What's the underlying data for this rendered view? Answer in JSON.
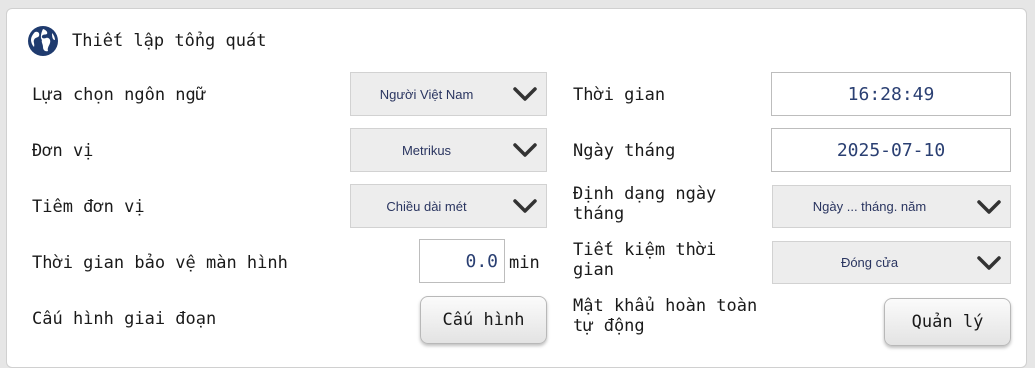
{
  "header": {
    "title": "Thiết lập tổng quát",
    "icon": "globe-icon"
  },
  "left": {
    "language_label": "Lựa chọn ngôn ngữ",
    "language_value": "Người Việt Nam",
    "unit_label": "Đơn vị",
    "unit_value": "Metrikus",
    "unit_prefix_label": "Tiêm đơn vị",
    "unit_prefix_value": "Chiều dài mét",
    "screensaver_label": "Thời gian bảo vệ màn hình",
    "screensaver_value": "0.0",
    "screensaver_unit": "min",
    "stage_config_label": "Cấu hình giai đoạn",
    "stage_config_button": "Cấu hình"
  },
  "right": {
    "time_label": "Thời gian",
    "time_value": "16:28:49",
    "date_label": "Ngày tháng",
    "date_value": "2025-07-10",
    "date_format_label": "Định dạng ngày tháng",
    "date_format_value": "Ngày ... tháng. năm",
    "dst_label": "Tiết kiệm thời gian",
    "dst_value": "Đóng cửa",
    "auto_password_label": "Mật khẩu hoàn toàn tự động",
    "manage_button": "Quản lý"
  },
  "colors": {
    "accent": "#1f3b6e",
    "value_text": "#2a3f72"
  }
}
